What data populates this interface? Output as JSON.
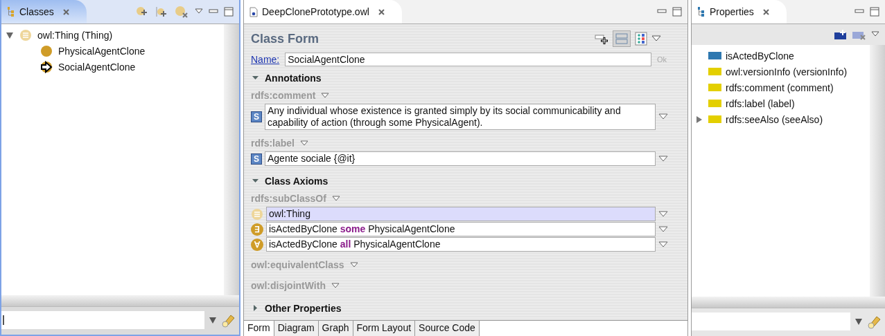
{
  "classes_view": {
    "title": "Classes",
    "tree": [
      {
        "label": "owl:Thing (Thing)",
        "kind": "thing",
        "expanded": true,
        "children": [
          {
            "label": "PhysicalAgentClone",
            "kind": "class"
          },
          {
            "label": "SocialAgentClone",
            "kind": "focused"
          }
        ]
      }
    ]
  },
  "editor": {
    "tab": "DeepClonePrototype.owl",
    "form_title": "Class Form",
    "name_label": "Name:",
    "name_value": "SocialAgentClone",
    "ok_label": "Ok",
    "sections": [
      {
        "title": "Annotations",
        "expanded": true,
        "groups": [
          {
            "property": "rdfs:comment",
            "values": [
              {
                "kind": "literal",
                "type_icon": "S",
                "text": "Any individual whose existence is granted simply by its social communicability and capability of action (through some PhysicalAgent).",
                "selected": false
              }
            ]
          },
          {
            "property": "rdfs:label",
            "values": [
              {
                "kind": "literal",
                "type_icon": "S",
                "text": "Agente sociale {@it}",
                "selected": false
              }
            ]
          }
        ]
      },
      {
        "title": "Class Axioms",
        "expanded": true,
        "groups": [
          {
            "property": "rdfs:subClassOf",
            "values": [
              {
                "kind": "named",
                "text": "owl:Thing",
                "selected": true
              },
              {
                "kind": "restriction",
                "symbol": "∃",
                "text": "isActedByClone **some** PhysicalAgentClone",
                "selected": false
              },
              {
                "kind": "restriction",
                "symbol": "∀",
                "text": "isActedByClone **all** PhysicalAgentClone",
                "selected": false
              }
            ]
          },
          {
            "property": "owl:equivalentClass"
          },
          {
            "property": "owl:disjointWith"
          }
        ]
      },
      {
        "title": "Other Properties",
        "expanded": false
      }
    ],
    "bottom_tabs": [
      {
        "label": "Form",
        "selected": true
      },
      {
        "label": "Diagram",
        "selected": false
      },
      {
        "label": "Graph",
        "selected": false
      },
      {
        "label": "Form Layout",
        "selected": false
      },
      {
        "label": "Source Code",
        "selected": false
      }
    ]
  },
  "properties_view": {
    "title": "Properties",
    "items": [
      {
        "label": "isActedByClone",
        "color": "#2e78b0",
        "expandable": false
      },
      {
        "label": "owl:versionInfo (versionInfo)",
        "color": "#e3cf00",
        "expandable": false
      },
      {
        "label": "rdfs:comment (comment)",
        "color": "#e3cf00",
        "expandable": false
      },
      {
        "label": "rdfs:label (label)",
        "color": "#e3cf00",
        "expandable": false
      },
      {
        "label": "rdfs:seeAlso (seeAlso)",
        "color": "#e3cf00",
        "expandable": true
      }
    ]
  }
}
